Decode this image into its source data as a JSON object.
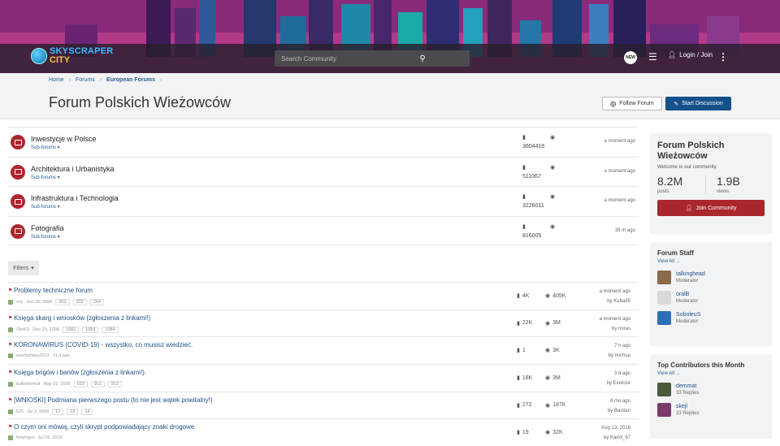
{
  "site": {
    "logo_line1": "SKYSCRAPER",
    "logo_line2": "CITY"
  },
  "topbar": {
    "search_placeholder": "Search Community",
    "new_badge": "NEW",
    "login_label": "Login / Join"
  },
  "breadcrumb": [
    "Home",
    "Forums",
    "European Forums"
  ],
  "page": {
    "title": "Forum Polskich Wieżowców",
    "follow_label": "Follow Forum",
    "start_label": "Start Discussion"
  },
  "subforums": [
    {
      "name": "Inwestycje w Polsce",
      "sub": "Sub-forums ▾",
      "count": "3604416",
      "time": "a moment ago"
    },
    {
      "name": "Architektura i Urbanistyka",
      "sub": "Sub-forums ▾",
      "count": "511067",
      "time": "a moment ago"
    },
    {
      "name": "Infrastruktura i Technologia",
      "sub": "Sub-forums ▾",
      "count": "3226011",
      "time": "a moment ago"
    },
    {
      "name": "Fotografia",
      "sub": "Sub-forums ▾",
      "count": "816005",
      "time": "39 m ago"
    }
  ],
  "filters_label": "Filters",
  "threads": [
    {
      "title": "Problemy techniczne forum",
      "author": "voy",
      "date": "Jun 28, 2008",
      "pages": [
        "202",
        "203",
        "204"
      ],
      "replies": "4K",
      "views": "405K",
      "last_time": "a moment ago",
      "last_by": "by Kuba85"
    },
    {
      "title": "Księga skarg i wniosków (zgłoszenia z linkami!)",
      "author": "OleKD",
      "date": "Dec 23, 2006",
      "pages": [
        "1082",
        "1083",
        "1084"
      ],
      "replies": "22K",
      "views": "3M",
      "last_time": "a moment ago",
      "last_by": "by noras"
    },
    {
      "title": "KORONAWIRUS (COVID-19) - wszystko, co musisz wiedzieć.",
      "author": "everfonfans2012",
      "date": "11 d ago",
      "pages": [],
      "replies": "1",
      "views": "3K",
      "last_time": "7 h ago",
      "last_by": "by michuu"
    },
    {
      "title": "Księga brigów i banów (zgłoszenia z linkami!)",
      "author": "kolbshemoit",
      "date": "May 31, 2006",
      "pages": [
        "910",
        "911",
        "912"
      ],
      "replies": "18K",
      "views": "3M",
      "last_time": "3 d ago",
      "last_by": "by Exelcior"
    },
    {
      "title": "[WNIOSKI] Podmiana pierwszego postu (to nie jest wątek powitalny!)",
      "author": "625",
      "date": "Jul 3, 2009",
      "pages": [
        "12",
        "13",
        "14"
      ],
      "replies": "272",
      "views": "187K",
      "last_time": "8 mo ago",
      "last_by": "by Bastian"
    },
    {
      "title": "O czym oni mówią, czyli skrypt podpowiadający znaki drogowe",
      "author": "fiefahgen",
      "date": "Jul 15, 2015",
      "pages": [],
      "replies": "19",
      "views": "32K",
      "last_time": "Aug 13, 2018",
      "last_by": "by Kamil_67"
    }
  ],
  "about": {
    "title": "Forum Polskich Wieżowców",
    "welcome": "Welcome to our community.",
    "posts_n": "8.2M",
    "posts_l": "posts",
    "views_n": "1.9B",
    "views_l": "views",
    "join_label": "Join Community"
  },
  "staff": {
    "title": "Forum Staff",
    "view_all": "View All",
    "members": [
      {
        "name": "talkinghead",
        "role": "Moderator"
      },
      {
        "name": "oralB",
        "role": "Moderator"
      },
      {
        "name": "SoboleuS",
        "role": "Moderator"
      }
    ]
  },
  "contrib": {
    "title": "Top Contributors this Month",
    "view_all": "View All",
    "members": [
      {
        "name": "demmat",
        "role": "33 Replies"
      },
      {
        "name": "skejl",
        "role": "33 Replies"
      }
    ]
  },
  "colors": {
    "accent_red": "#a8262c",
    "accent_blue": "#14508a",
    "link": "#1d4f86"
  }
}
